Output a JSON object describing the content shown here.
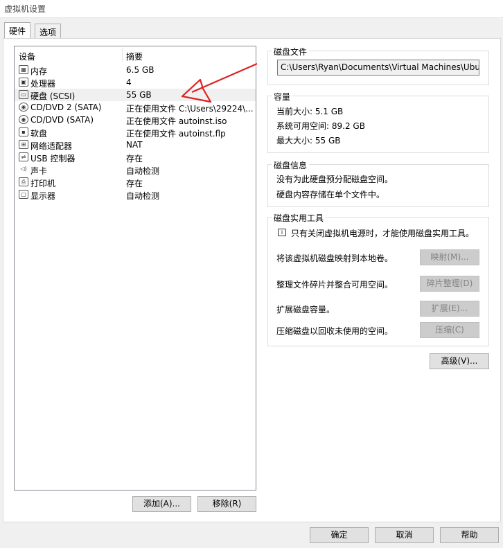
{
  "window": {
    "title": "虚拟机设置"
  },
  "tabs": [
    {
      "label": "硬件",
      "active": true
    },
    {
      "label": "选项",
      "active": false
    }
  ],
  "device_list": {
    "columns": [
      "设备",
      "摘要"
    ],
    "rows": [
      {
        "name": "内存",
        "summary": "6.5 GB",
        "icon": "memory-icon"
      },
      {
        "name": "处理器",
        "summary": "4",
        "icon": "processor-icon"
      },
      {
        "name": "硬盘 (SCSI)",
        "summary": "55 GB",
        "icon": "hard-disk-icon",
        "selected": true
      },
      {
        "name": "CD/DVD 2 (SATA)",
        "summary": "正在使用文件 C:\\Users\\29224\\...",
        "icon": "cd-dvd-icon"
      },
      {
        "name": "CD/DVD (SATA)",
        "summary": "正在使用文件 autoinst.iso",
        "icon": "cd-dvd-icon"
      },
      {
        "name": "软盘",
        "summary": "正在使用文件 autoinst.flp",
        "icon": "floppy-icon"
      },
      {
        "name": "网络适配器",
        "summary": "NAT",
        "icon": "network-adapter-icon"
      },
      {
        "name": "USB 控制器",
        "summary": "存在",
        "icon": "usb-icon"
      },
      {
        "name": "声卡",
        "summary": "自动检测",
        "icon": "sound-card-icon"
      },
      {
        "name": "打印机",
        "summary": "存在",
        "icon": "printer-icon"
      },
      {
        "name": "显示器",
        "summary": "自动检测",
        "icon": "display-icon"
      }
    ]
  },
  "list_buttons": {
    "add": "添加(A)...",
    "remove": "移除(R)"
  },
  "disk_file": {
    "title": "磁盘文件",
    "path": "C:\\Users\\Ryan\\Documents\\Virtual Machines\\Ubuntu"
  },
  "capacity": {
    "title": "容量",
    "current_size": "当前大小: 5.1 GB",
    "available_space": "系统可用空间: 89.2 GB",
    "max_size": "最大大小: 55 GB"
  },
  "disk_info": {
    "title": "磁盘信息",
    "line1": "没有为此硬盘预分配磁盘空间。",
    "line2": "硬盘内容存储在单个文件中。"
  },
  "disk_utilities": {
    "title": "磁盘实用工具",
    "notice": "只有关闭虚拟机电源时，才能使用磁盘实用工具。",
    "items": [
      {
        "label": "将该虚拟机磁盘映射到本地卷。",
        "button": "映射(M)..."
      },
      {
        "label": "整理文件碎片并整合可用空间。",
        "button": "碎片整理(D)"
      },
      {
        "label": "扩展磁盘容量。",
        "button": "扩展(E)..."
      },
      {
        "label": "压缩磁盘以回收未使用的空间。",
        "button": "压缩(C)"
      }
    ]
  },
  "advanced_button": "高级(V)...",
  "footer": {
    "ok": "确定",
    "cancel": "取消",
    "help": "帮助"
  },
  "annotation": {
    "arrow_color": "#e02020"
  }
}
